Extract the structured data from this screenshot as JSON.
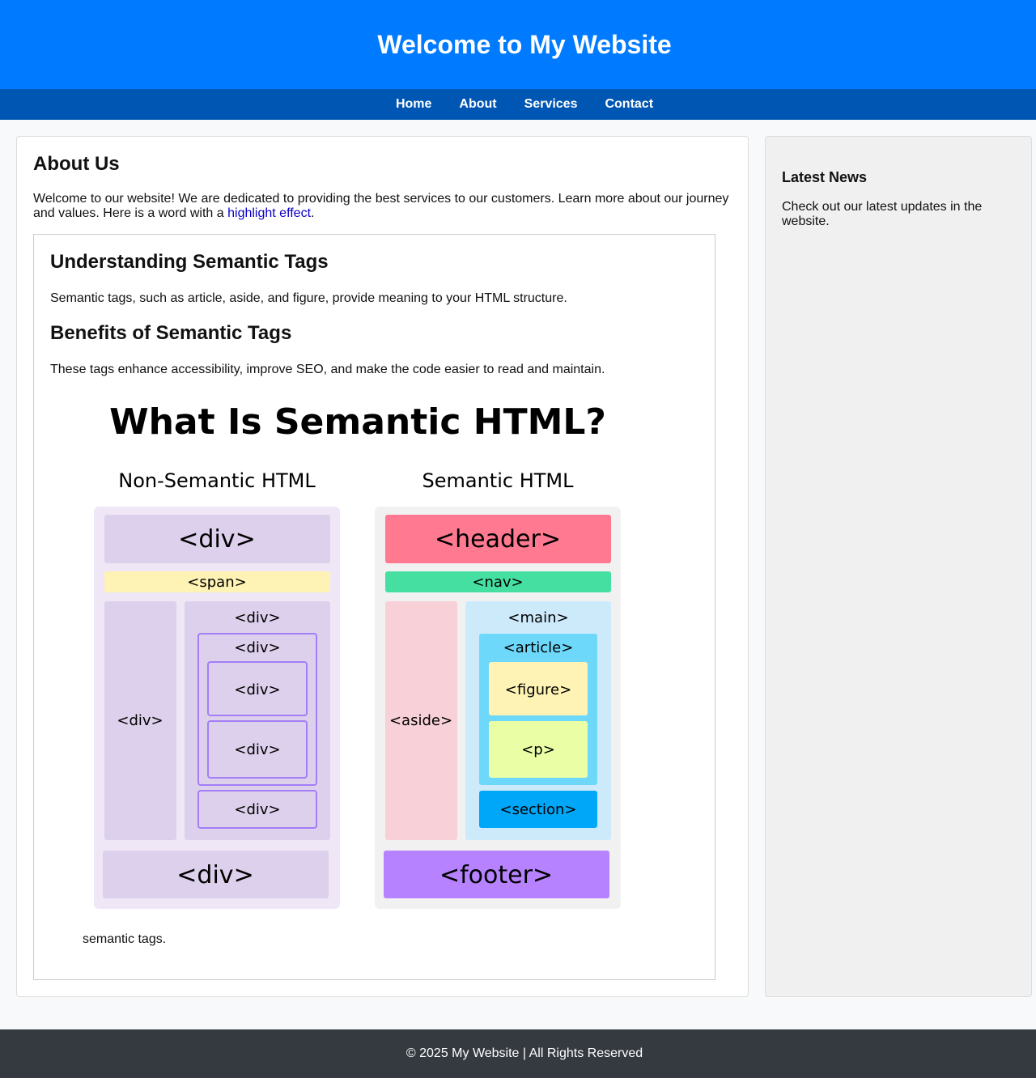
{
  "header": {
    "title": "Welcome to My Website"
  },
  "nav": {
    "items": [
      "Home",
      "About",
      "Services",
      "Contact"
    ]
  },
  "main": {
    "heading": "About Us",
    "intro_text": "Welcome to our website! We are dedicated to providing the best services to our customers. Learn more about our journey and values. Here is a word with a ",
    "highlight_text": "highlight effect",
    "intro_end": ".",
    "article": {
      "section1_title": "Understanding Semantic Tags",
      "section1_text": "Semantic tags, such as article, aside, and figure, provide meaning to your HTML structure.",
      "section2_title": "Benefits of Semantic Tags",
      "section2_text": "These tags enhance accessibility, improve SEO, and make the code easier to read and maintain.",
      "caption": "semantic tags."
    },
    "figure": {
      "title": "What Is Semantic HTML?",
      "non_semantic_label": "Non-Semantic HTML",
      "semantic_label": "Semantic HTML",
      "non_semantic_tags": {
        "header": "<div>",
        "nav": "<span>",
        "aside": "<div>",
        "main": "<div>",
        "article": "<div>",
        "figure": "<div>",
        "p": "<div>",
        "section": "<div>",
        "footer": "<div>"
      },
      "semantic_tags": {
        "header": "<header>",
        "nav": "<nav>",
        "aside": "<aside>",
        "main": "<main>",
        "article": "<article>",
        "figure": "<figure>",
        "p": "<p>",
        "section": "<section>",
        "footer": "<footer>"
      }
    }
  },
  "sidebar": {
    "title": "Latest News",
    "text": "Check out our latest updates in the website."
  },
  "footer": {
    "text": "© 2025 My Website | All Rights Reserved"
  },
  "colors": {
    "header_bg": "#007bff",
    "nav_bg": "#0056b3",
    "footer_bg": "#343a40",
    "highlight": "#0a00c8"
  }
}
